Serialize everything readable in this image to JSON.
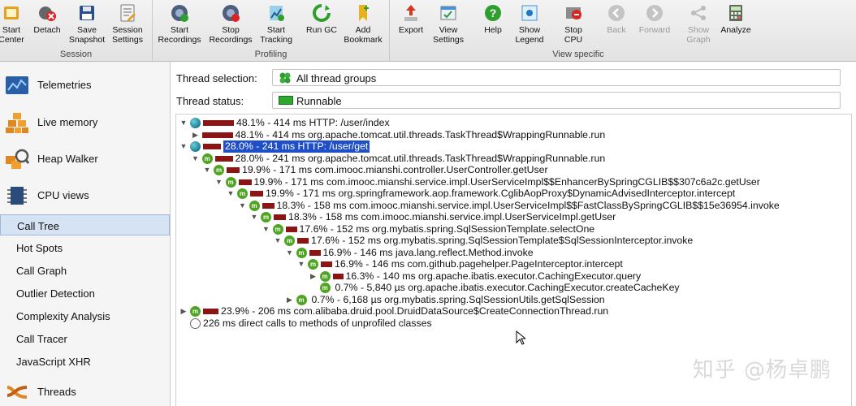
{
  "toolbar": {
    "groups": [
      {
        "label": "Session"
      },
      {
        "label": "Profiling"
      },
      {
        "label": "View specific"
      }
    ],
    "buttons": [
      {
        "label": "Start\nCenter",
        "icon": "start-center-icon"
      },
      {
        "label": "Detach",
        "icon": "detach-icon"
      },
      {
        "label": "Save\nSnapshot",
        "icon": "save-icon"
      },
      {
        "label": "Session\nSettings",
        "icon": "session-settings-icon"
      },
      {
        "label": "Start\nRecordings",
        "icon": "start-recordings-icon"
      },
      {
        "label": "Stop\nRecordings",
        "icon": "stop-recordings-icon"
      },
      {
        "label": "Start\nTracking",
        "icon": "start-tracking-icon"
      },
      {
        "label": "Run GC",
        "icon": "run-gc-icon"
      },
      {
        "label": "Add\nBookmark",
        "icon": "bookmark-icon"
      },
      {
        "label": "Export",
        "icon": "export-icon"
      },
      {
        "label": "View\nSettings",
        "icon": "view-settings-icon"
      },
      {
        "label": "Help",
        "icon": "help-icon"
      },
      {
        "label": "Show\nLegend",
        "icon": "legend-icon"
      },
      {
        "label": "Stop\nCPU",
        "icon": "stop-cpu-icon"
      },
      {
        "label": "Back",
        "icon": "back-icon",
        "disabled": true
      },
      {
        "label": "Forward",
        "icon": "forward-icon",
        "disabled": true
      },
      {
        "label": "Show\nGraph",
        "icon": "graph-icon",
        "disabled": true
      },
      {
        "label": "Analyze",
        "icon": "analyze-icon"
      }
    ]
  },
  "sidebar": {
    "sections": [
      {
        "label": "Telemetries",
        "icon": "telemetries-icon"
      },
      {
        "label": "Live memory",
        "icon": "live-memory-icon"
      },
      {
        "label": "Heap Walker",
        "icon": "heap-walker-icon"
      },
      {
        "label": "CPU views",
        "icon": "cpu-views-icon"
      }
    ],
    "cpu_items": [
      {
        "label": "Call Tree",
        "selected": true
      },
      {
        "label": "Hot Spots"
      },
      {
        "label": "Call Graph"
      },
      {
        "label": "Outlier Detection"
      },
      {
        "label": "Complexity Analysis"
      },
      {
        "label": "Call Tracer"
      },
      {
        "label": "JavaScript XHR"
      }
    ],
    "threads": {
      "label": "Threads",
      "icon": "threads-icon"
    }
  },
  "filters": {
    "thread_selection": {
      "label": "Thread selection:",
      "value": "All thread groups"
    },
    "thread_status": {
      "label": "Thread status:",
      "value": "Runnable"
    }
  },
  "tree": [
    {
      "depth": 0,
      "toggle": "▼",
      "icon": "globe",
      "pct": 48.1,
      "text": "48.1% - 414 ms HTTP: /user/index"
    },
    {
      "depth": 1,
      "toggle": "▶",
      "icon": "none",
      "pct": 48.1,
      "text": "48.1% - 414 ms org.apache.tomcat.util.threads.TaskThread$WrappingRunnable.run"
    },
    {
      "depth": 0,
      "toggle": "▼",
      "icon": "globe",
      "pct": 28.0,
      "text": "28.0% - 241 ms HTTP: /user/get",
      "highlight": true
    },
    {
      "depth": 1,
      "toggle": "▼",
      "icon": "m",
      "pct": 28.0,
      "text": "28.0% - 241 ms org.apache.tomcat.util.threads.TaskThread$WrappingRunnable.run"
    },
    {
      "depth": 2,
      "toggle": "▼",
      "icon": "m",
      "pct": 19.9,
      "text": "19.9% - 171 ms com.imooc.mianshi.controller.UserController.getUser"
    },
    {
      "depth": 3,
      "toggle": "▼",
      "icon": "m",
      "pct": 19.9,
      "text": "19.9% - 171 ms com.imooc.mianshi.service.impl.UserServiceImpl$$EnhancerBySpringCGLIB$$307c6a2c.getUser"
    },
    {
      "depth": 4,
      "toggle": "▼",
      "icon": "m",
      "pct": 19.9,
      "text": "19.9% - 171 ms org.springframework.aop.framework.CglibAopProxy$DynamicAdvisedInterceptor.intercept"
    },
    {
      "depth": 5,
      "toggle": "▼",
      "icon": "m",
      "pct": 18.3,
      "text": "18.3% - 158 ms com.imooc.mianshi.service.impl.UserServiceImpl$$FastClassBySpringCGLIB$$15e36954.invoke"
    },
    {
      "depth": 6,
      "toggle": "▼",
      "icon": "m",
      "pct": 18.3,
      "text": "18.3% - 158 ms com.imooc.mianshi.service.impl.UserServiceImpl.getUser"
    },
    {
      "depth": 7,
      "toggle": "▼",
      "icon": "m",
      "pct": 17.6,
      "text": "17.6% - 152 ms org.mybatis.spring.SqlSessionTemplate.selectOne"
    },
    {
      "depth": 8,
      "toggle": "▼",
      "icon": "m",
      "pct": 17.6,
      "text": "17.6% - 152 ms org.mybatis.spring.SqlSessionTemplate$SqlSessionInterceptor.invoke"
    },
    {
      "depth": 9,
      "toggle": "▼",
      "icon": "m",
      "pct": 16.9,
      "text": "16.9% - 146 ms java.lang.reflect.Method.invoke"
    },
    {
      "depth": 10,
      "toggle": "▼",
      "icon": "m",
      "pct": 16.9,
      "text": "16.9% - 146 ms com.github.pagehelper.PageInterceptor.intercept"
    },
    {
      "depth": 11,
      "toggle": "▶",
      "icon": "m",
      "pct": 16.3,
      "text": "16.3% - 140 ms org.apache.ibatis.executor.CachingExecutor.query"
    },
    {
      "depth": 11,
      "toggle": "",
      "icon": "m",
      "pct": 0,
      "text": "0.7% - 5,840 µs org.apache.ibatis.executor.CachingExecutor.createCacheKey"
    },
    {
      "depth": 9,
      "toggle": "▶",
      "icon": "m",
      "pct": 0,
      "text": "0.7% - 6,168 µs org.mybatis.spring.SqlSessionUtils.getSqlSession"
    },
    {
      "depth": 0,
      "toggle": "▶",
      "icon": "m",
      "pct": 23.9,
      "text": "23.9% - 206 ms com.alibaba.druid.pool.DruidDataSource$CreateConnectionThread.run"
    },
    {
      "depth": 0,
      "toggle": "",
      "icon": "clock",
      "pct": 0,
      "text": "226 ms direct calls to methods of unprofiled classes"
    }
  ],
  "colors": {
    "bar": "#8b1414",
    "selection": "#1f4fc7",
    "sidebar_selected": "#d5e3f4"
  },
  "watermark": "知乎 @杨卓鹏"
}
